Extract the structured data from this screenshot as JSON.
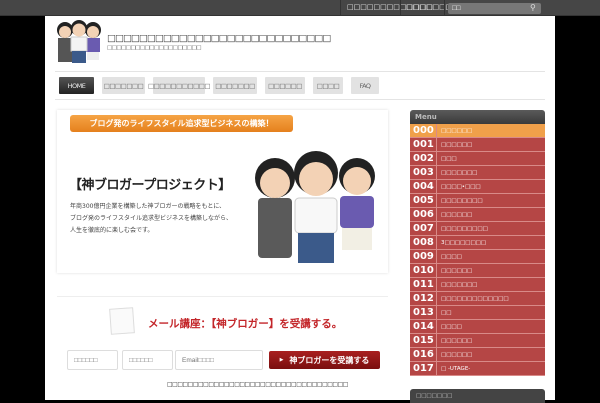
{
  "topbar": {
    "link1": "□□□□□□□□□□□□□",
    "link2": "□□□□□□□",
    "link2_arrow": "▾",
    "search_value": "□□"
  },
  "header": {
    "title": "□□□□□□□□□□□□□□□□□□□□□□□□□□□□",
    "subtitle": "□□□□□□□□□□□□□□□□□□□□"
  },
  "nav": [
    {
      "label": "HOME"
    },
    {
      "label": "□□□□□□□"
    },
    {
      "label": "□□□□□□□□□□□"
    },
    {
      "label": "□□□□□□□"
    },
    {
      "label": "□□□□□□"
    },
    {
      "label": "□□□□"
    },
    {
      "label": "FAQ"
    }
  ],
  "hero": {
    "banner": "ブログ発のライフスタイル追求型ビジネスの構築！",
    "title": "【神ブロガープロジェクト】",
    "desc": [
      "年商300億円企業を構築した神ブロガーの戦略をもとに、",
      "ブログ発のライフスタイル追求型ビジネスを構築しながら、",
      "人生を徹底的に楽しむ会です。"
    ]
  },
  "signup": {
    "title": "メール講座：【神ブロガー】を受講する。",
    "field1": "□□□□□□",
    "field2": "□□□□□□",
    "field3": "Email□□□□",
    "button": "神ブロガーを受講する",
    "footnote": "□□□□□□□□□□□□□□□□□□□□□□□□□□□□□□□□□□□"
  },
  "menu": {
    "title": "Menu",
    "items": [
      {
        "num": "000",
        "label": "□□□□□□"
      },
      {
        "num": "001",
        "label": "□□□□□□"
      },
      {
        "num": "002",
        "label": "□□□"
      },
      {
        "num": "003",
        "label": "□□□□□□□"
      },
      {
        "num": "004",
        "label": "□□□□•□□□"
      },
      {
        "num": "005",
        "label": "□□□□□□□□"
      },
      {
        "num": "006",
        "label": "□□□□□□"
      },
      {
        "num": "007",
        "label": "□□□□□□□□□"
      },
      {
        "num": "008",
        "label": "3□□□□□□□□"
      },
      {
        "num": "009",
        "label": "□□□□"
      },
      {
        "num": "010",
        "label": "□□□□□□"
      },
      {
        "num": "011",
        "label": "□□□□□□□"
      },
      {
        "num": "012",
        "label": "□□□□□□□□□□□□□"
      },
      {
        "num": "013",
        "label": "□□"
      },
      {
        "num": "014",
        "label": "□□□□"
      },
      {
        "num": "015",
        "label": "□□□□□□"
      },
      {
        "num": "016",
        "label": "□□□□□□"
      },
      {
        "num": "017",
        "label": "□ -UTAGE-"
      }
    ]
  },
  "sidebar_box2": {
    "title": "□□□□□□□"
  }
}
